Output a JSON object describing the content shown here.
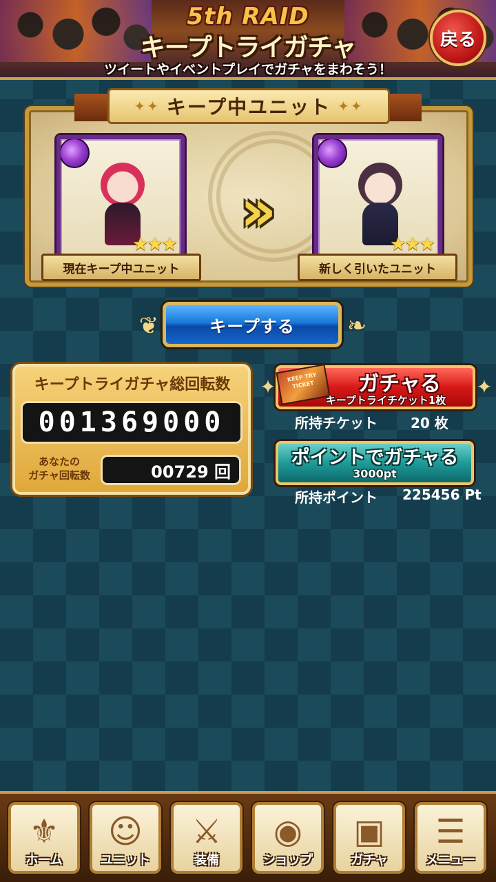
{
  "banner": {
    "raid": "5th RAID",
    "title": "キープトライガチャ",
    "subtitle": "ツイートやイベントプレイでガチャをまわそう！",
    "back_label": "戻る"
  },
  "keep": {
    "header": "キープ中ユニット",
    "current_caption": "現在キープ中ユニット",
    "new_caption": "新しく引いたユニット",
    "current_stars": "★★★",
    "new_stars": "★★★",
    "keep_button": "キープする"
  },
  "counter": {
    "title": "キープトライガチャ総回転数",
    "total": "001369000",
    "your_label_line1": "あなたの",
    "your_label_line2": "ガチャ回転数",
    "your_count": "00729 回"
  },
  "ticket_gacha": {
    "ticket_text": "KEEP TRY TICKET",
    "label": "ガチャる",
    "cost": "キープトライチケット1枚",
    "owned_label": "所持チケット",
    "owned_value": "20 枚"
  },
  "point_gacha": {
    "label": "ポイントでガチャる",
    "cost": "3000pt",
    "owned_label": "所持ポイント",
    "owned_value": "225456 Pt"
  },
  "nav": [
    {
      "label": "ホーム",
      "icon": "fleur-icon"
    },
    {
      "label": "ユニット",
      "icon": "character-icon"
    },
    {
      "label": "装備",
      "icon": "swords-icon"
    },
    {
      "label": "ショップ",
      "icon": "coin-icon"
    },
    {
      "label": "ガチャ",
      "icon": "cards-icon"
    },
    {
      "label": "メニュー",
      "icon": "menu-icon"
    }
  ],
  "colors": {
    "background": "#1b4a5a",
    "gold": "#c69a3a",
    "keep_button": "#1a78d8",
    "ticket_button": "#d81818",
    "point_button": "#1e9a98",
    "back_button": "#c01818"
  }
}
